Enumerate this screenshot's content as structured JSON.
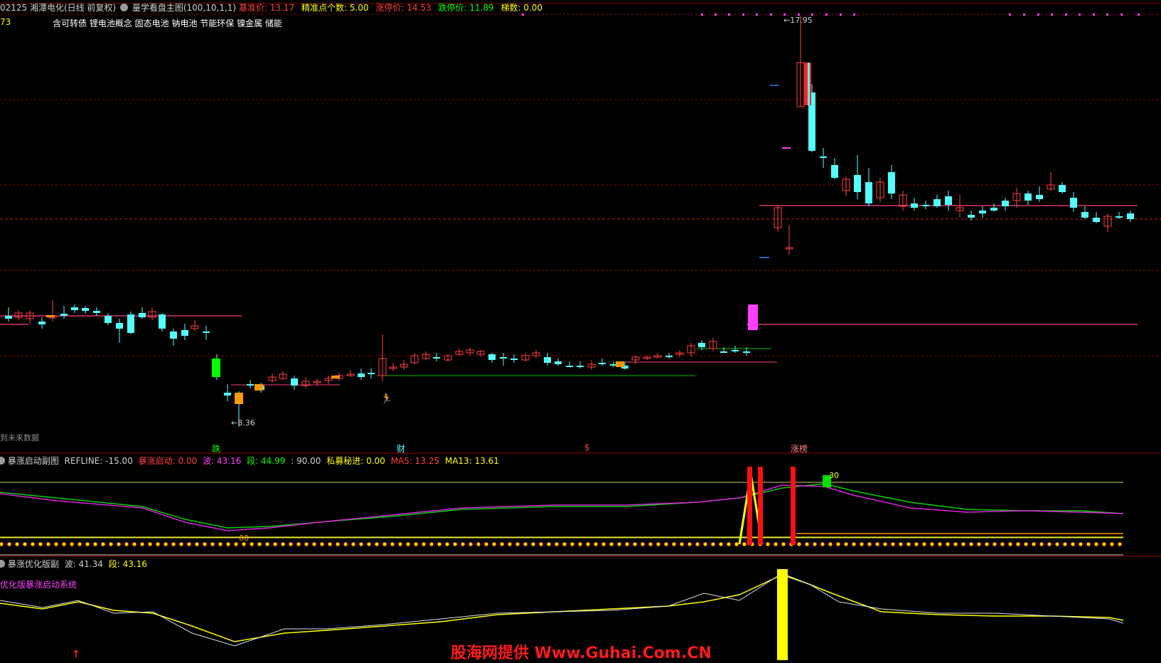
{
  "colors": {
    "red": "#ff4040",
    "cyan": "#54ffff",
    "yellow": "#ffff00",
    "magenta": "#ff40ff",
    "green": "#00ff00",
    "orange": "#ff9900",
    "white": "#e0e0e0",
    "gridred": "#8b0000"
  },
  "header": {
    "stock_title": "02125 湘潭电化(日线 前复权)",
    "indicator_name": "量学看盘主图(100,10,1,1)",
    "base_price_label": "基准价: ",
    "base_price_value": "13.17",
    "precise_points_label": "精准点个数: ",
    "precise_points_value": "5.00",
    "limit_up_label": "涨停价: ",
    "limit_up_value": "14.53",
    "limit_down_label": "跌停价: ",
    "limit_down_value": "11.89",
    "ladder_label": "梯数: ",
    "ladder_value": "0.00",
    "left_value": "73",
    "concepts": "含可转债 锂电池概念 固态电池 钠电池 节能环保 镍金属 储能"
  },
  "price_panel": {
    "high_label": "17.95",
    "low_label": "8.36",
    "future_data_note": "到未来数据",
    "markers": [
      "跌",
      "财",
      "$",
      "涨榜"
    ]
  },
  "indicator1": {
    "name": "暴涨启动副图",
    "refline_label": "REFLINE: ",
    "refline_value": "-15.00",
    "start_label": "暴涨启动: ",
    "start_value": "0.00",
    "wave_label": "波: ",
    "wave_value": "43.16",
    "segment_label": "段: ",
    "segment_value": "44.99",
    "ninety_label": ": ",
    "ninety_value": "90.00",
    "private_label": "私募秘进: ",
    "private_value": "0.00",
    "ma5_label": "MA5: ",
    "ma5_value": "13.25",
    "ma13_label": "MA13: ",
    "ma13_value": "13.61",
    "marker_30": "30",
    "marker_00": "00"
  },
  "indicator2": {
    "name": "暴涨优化版副",
    "wave_label": "波: ",
    "wave_value": "41.34",
    "segment_label": "段: ",
    "segment_value": "43.16",
    "system_name": "优化版暴涨启动系统"
  },
  "watermark": "股海网提供 Www.Guhai.Com.CN",
  "icons": {
    "settings": "gear-icon",
    "arrow_up": "up-arrow-icon",
    "runner": "runner-icon"
  }
}
